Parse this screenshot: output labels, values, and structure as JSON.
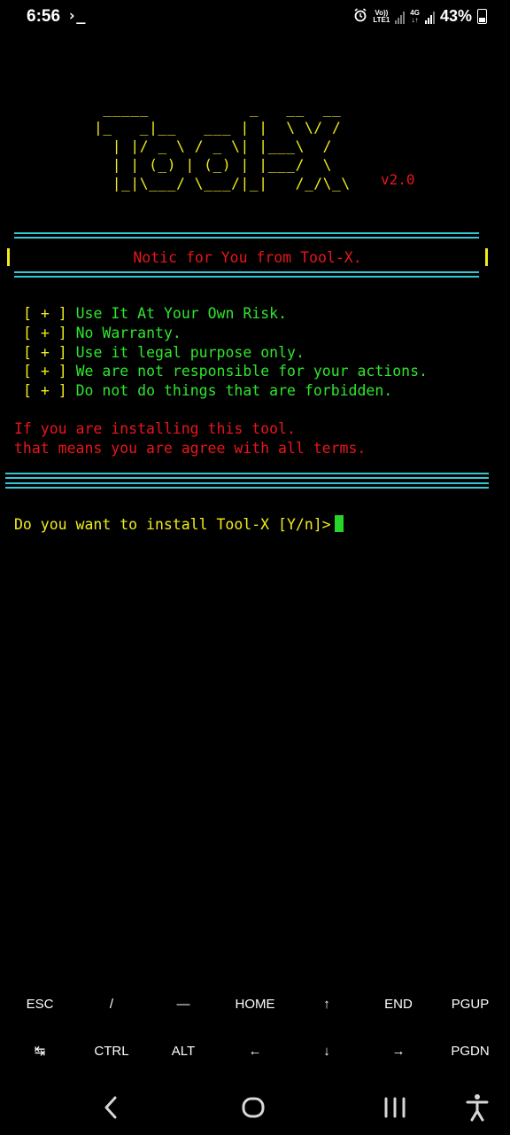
{
  "status_bar": {
    "time": "6:56",
    "term_glyph": "›_",
    "volte_top": "Vo))",
    "volte_bottom": "LTE1",
    "net_top": "4G",
    "net_bottom": "↓↑",
    "battery": "43%"
  },
  "terminal": {
    "ascii_art": " _____           _   __  __\n|_   _|__   ___ | |  \\ \\/ /\n  | |/ _ \\ / _ \\| |___\\  /\n  | | (_) | (_) | |___/  \\\n  |_|\\___/ \\___/|_|   /_/\\_\\",
    "version": "v2.0",
    "separator": "==============================================",
    "notice_title": "Notic for You from Tool-X.",
    "bracket": "[ + ]",
    "rules": [
      "Use It At Your Own Risk.",
      "No Warranty.",
      "Use it legal purpose only.",
      "We are not responsible for your actions.",
      "Do not do things that are forbidden."
    ],
    "warning_line_1": "If you are installing this tool.",
    "warning_line_2": "that means you are agree with all terms.",
    "prompt": "Do you want to install Tool-X [Y/n]>"
  },
  "extra_keys": {
    "row1": [
      "ESC",
      "/",
      "—",
      "HOME",
      "↑",
      "END",
      "PGUP"
    ],
    "row2": [
      "↹",
      "CTRL",
      "ALT",
      "←",
      "↓",
      "→",
      "PGDN"
    ]
  },
  "colors": {
    "background": "#000000",
    "ascii_yellow": "#f1ec1c",
    "notice_red": "#e8161b",
    "rule_green": "#2ee62e",
    "separator_cyan": "#35c7d6",
    "cursor_green": "#25d629"
  }
}
